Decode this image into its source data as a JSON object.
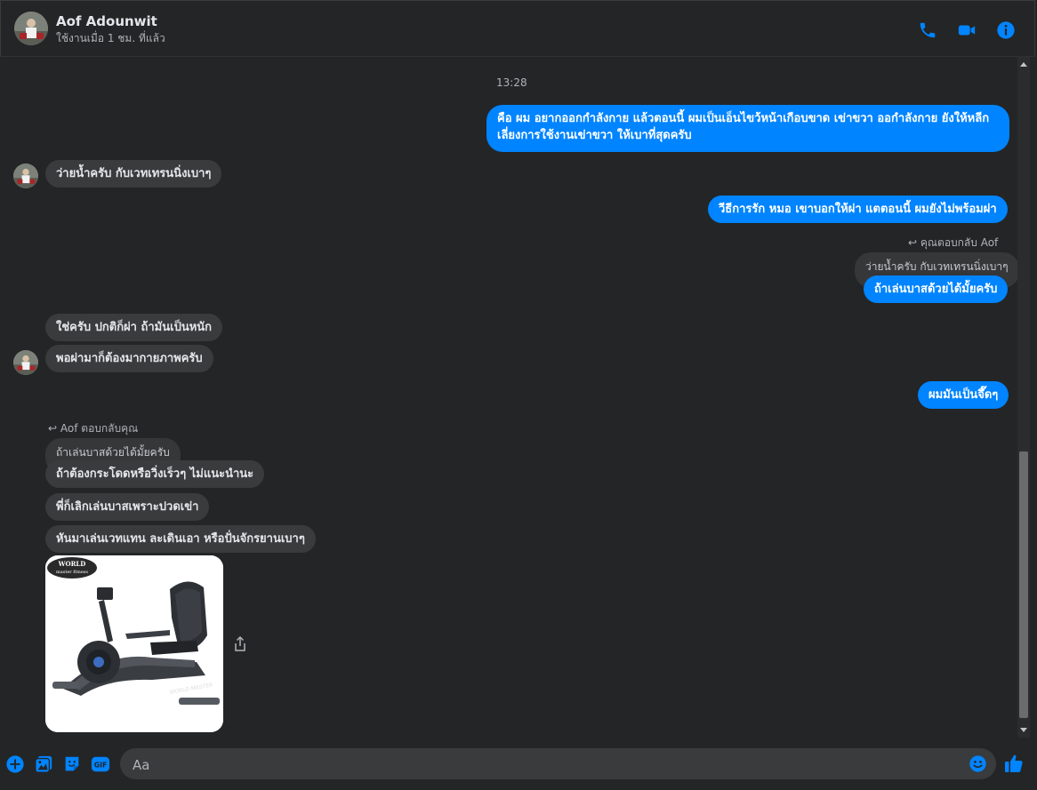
{
  "header": {
    "name": "Aof Adounwit",
    "status": "ใช้งานเมื่อ 1 ชม. ที่แล้ว",
    "icons": [
      "phone-icon",
      "video-icon",
      "info-icon"
    ],
    "accent": "#0084ff"
  },
  "thread": {
    "timestamp": "13:28",
    "messages": {
      "m1": "คือ ผม อยากออกกำลังกาย แล้วตอนนี้ ผมเป็นเอ็นไขว้หน้าเกือบขาด เข่าขวา ออกำลังกาย ยังให้หลีก",
      "m1b": "เลี่ยงการใช้งานเข่าขวา ให้เบาที่สุดครับ",
      "m2": "ว่ายน้ำครับ กับเวทเทรนนิ่งเบาๆ",
      "m3": "วีธีการรัก หมอ เขาบอกให้ผ่า แตตอนนี้ ผมยังไม่พร้อมผ่า",
      "reply_label_out": "คุณตอบกลับ Aof",
      "quoted_out": "ว่ายน้ำครับ กับเวทเทรนนิ่งเบาๆ",
      "m4": "ถ้าเล่นบาสด้วยได้มั้ยครับ",
      "m5": "ใช่ครับ ปกติก็ผ่า ถ้ามันเป็นหนัก",
      "m6": "พอผ่ามาก็ต้องมากายภาพครับ",
      "m7": "ผมมันเป็นจึ๊ดๆ",
      "reply_label_in": "Aof ตอบกลับคุณ",
      "quoted_in": "ถ้าเล่นบาสด้วยได้มั้ยครับ",
      "m8": "ถ้าต้องกระโดดหรือวิ่งเร็วๆ ไม่แนะนำนะ",
      "m9": "พี่ก็เลิกเล่นบาสเพราะปวดเข่า",
      "m10": "หันมาเล่นเวทแทน ละเดินเอา หรือปั่นจักรยานเบาๆ"
    },
    "image": {
      "logo_line1": "WORLD",
      "logo_line2": "master fitness",
      "bike_text": "WORLD MASTER"
    }
  },
  "composer": {
    "placeholder": "Aa",
    "icons": [
      "plus-icon",
      "photo-icon",
      "sticker-icon",
      "gif-icon",
      "emoji-icon",
      "like-icon"
    ]
  }
}
